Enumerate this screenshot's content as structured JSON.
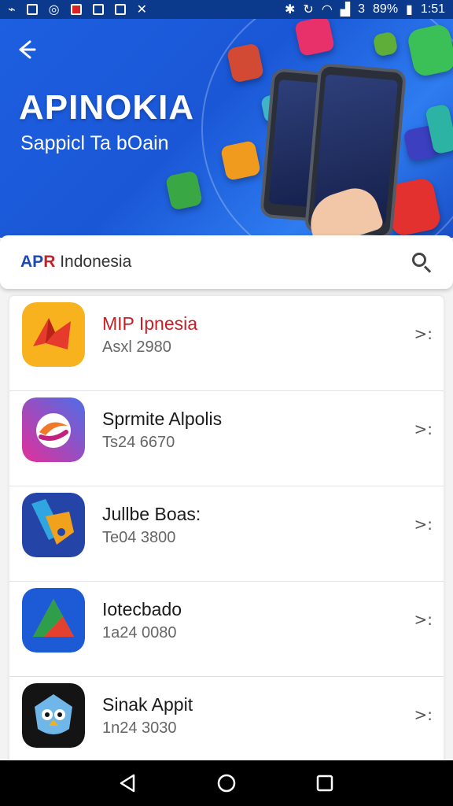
{
  "status_bar": {
    "battery": "89%",
    "time": "1:51",
    "carrier": "3"
  },
  "hero": {
    "title": "APINOKIA",
    "subtitle": "Sappicl Ta bOain"
  },
  "search": {
    "brand_a": "AP",
    "brand_r": "R",
    "rest": " Indonesia"
  },
  "apps": [
    {
      "name": "MIP Ipnesia",
      "meta": "Asxl 2980",
      "icon": "red-origami-app-icon",
      "colors": [
        "#f7b21d",
        "#e53a2c"
      ]
    },
    {
      "name": "Sprmite Alpolis",
      "meta": "Ts24 6670",
      "icon": "magenta-swirl-app-icon",
      "colors": [
        "#e22f9a",
        "#6b4ee0"
      ]
    },
    {
      "name": "Jullbe Boas:",
      "meta": "Te04 3800",
      "icon": "blue-paper-app-icon",
      "colors": [
        "#2544a8",
        "#f1a11c"
      ]
    },
    {
      "name": "Iotecbado",
      "meta": "1a24 0080",
      "icon": "blue-triangle-app-icon",
      "colors": [
        "#1d5bd6",
        "#f2b020"
      ]
    },
    {
      "name": "Sinak Appit",
      "meta": "1n24 3030",
      "icon": "penguin-app-icon",
      "colors": [
        "#141414",
        "#6fb7e9"
      ]
    }
  ],
  "chevron_label": ">:",
  "colors": {
    "hero": "#1d5fe0",
    "accent_red": "#c61f26",
    "accent_blue": "#1a49b8"
  }
}
